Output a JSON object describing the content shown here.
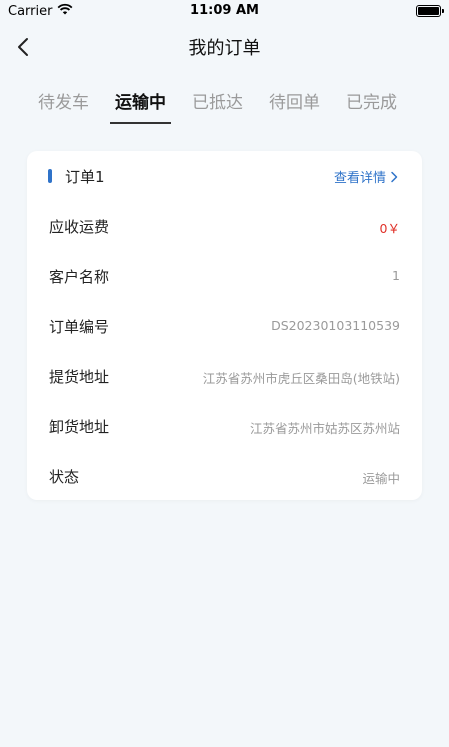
{
  "status": {
    "carrier": "Carrier",
    "time": "11:09 AM"
  },
  "nav": {
    "title": "我的订单"
  },
  "tabs": [
    {
      "label": "待发车"
    },
    {
      "label": "运输中"
    },
    {
      "label": "已抵达"
    },
    {
      "label": "待回单"
    },
    {
      "label": "已完成"
    }
  ],
  "active_tab": "运输中",
  "order": {
    "title": "订单1",
    "detail_link": "查看详情",
    "rows": [
      {
        "label": "应收运费",
        "value": "0￥"
      },
      {
        "label": "客户名称",
        "value": "1"
      },
      {
        "label": "订单编号",
        "value": "DS20230103110539"
      },
      {
        "label": "提货地址",
        "value": "江苏省苏州市虎丘区桑田岛(地铁站)"
      },
      {
        "label": "卸货地址",
        "value": "江苏省苏州市姑苏区苏州站"
      },
      {
        "label": "状态",
        "value": "运输中"
      }
    ]
  },
  "colors": {
    "accent": "#2f73c9",
    "price": "#e0322a",
    "background": "#f3f7fa"
  }
}
